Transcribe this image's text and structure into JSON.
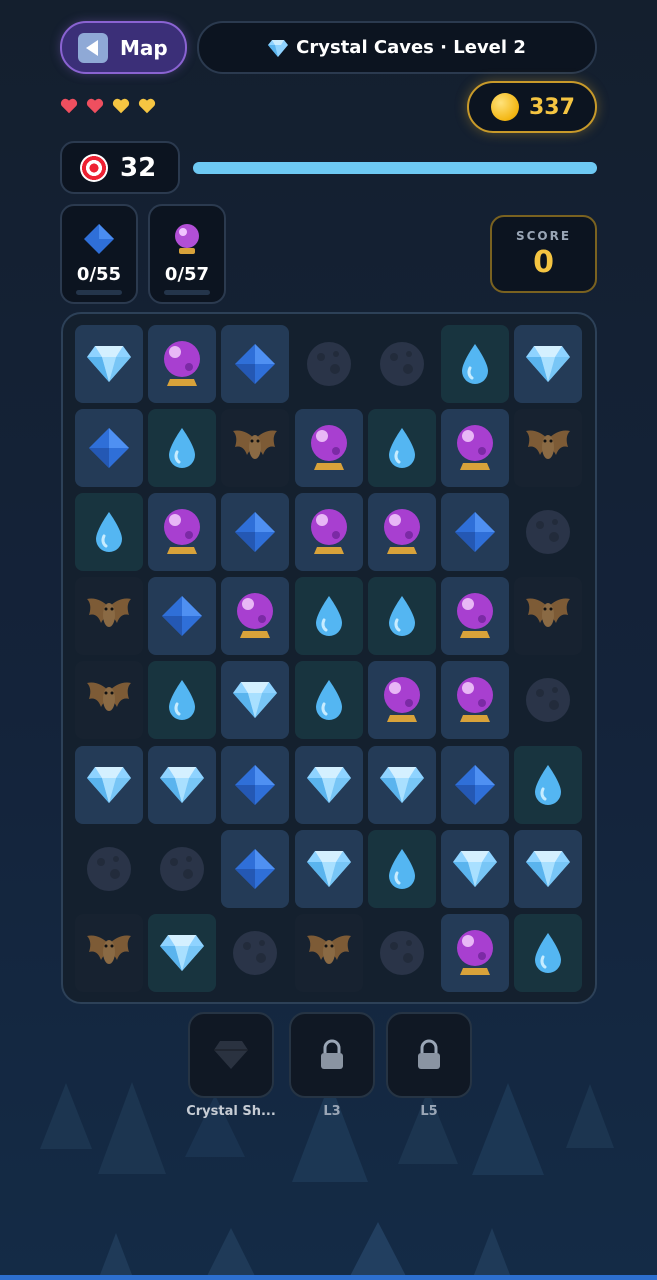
{
  "header": {
    "map_label": "Map",
    "level_title": "Crystal Caves · Level 2"
  },
  "lives": {
    "full": 2,
    "partial": 2,
    "colors": [
      "#ef4f5f",
      "#ef4f5f",
      "#f5c542",
      "#f5c542"
    ]
  },
  "coins": "337",
  "moves": "32",
  "move_progress": 1.0,
  "goals": [
    {
      "icon": "blue-diamond-icon",
      "count": "0/55"
    },
    {
      "icon": "crystal-ball-icon",
      "count": "0/57"
    }
  ],
  "score": {
    "label": "SCORE",
    "value": "0"
  },
  "board": {
    "rows": [
      [
        "gem",
        "ball",
        "diamond",
        "moon",
        "moon",
        "drop",
        "gem"
      ],
      [
        "diamond",
        "drop",
        "bat",
        "ball",
        "drop",
        "ball",
        "bat"
      ],
      [
        "drop",
        "ball",
        "diamond",
        "ball",
        "ball",
        "diamond",
        "moon"
      ],
      [
        "bat",
        "diamond",
        "ball",
        "drop",
        "drop",
        "ball",
        "bat"
      ],
      [
        "bat",
        "drop",
        "gem",
        "drop",
        "ball",
        "ball",
        "moon"
      ],
      [
        "gem",
        "gem",
        "diamond",
        "gem",
        "gem",
        "diamond",
        "drop"
      ],
      [
        "moon",
        "moon",
        "diamond",
        "gem",
        "drop",
        "gem",
        "gem"
      ],
      [
        "bat",
        "gem",
        "moon",
        "bat",
        "moon",
        "ball",
        "drop"
      ]
    ],
    "cell_bg": [
      [
        "blue",
        "blue",
        "blue",
        "none",
        "none",
        "teal",
        "blue"
      ],
      [
        "blue",
        "teal",
        "dark",
        "blue",
        "teal",
        "blue",
        "dark"
      ],
      [
        "teal",
        "blue",
        "blue",
        "blue",
        "blue",
        "blue",
        "none"
      ],
      [
        "dark",
        "blue",
        "blue",
        "teal",
        "teal",
        "blue",
        "dark"
      ],
      [
        "dark",
        "teal",
        "blue",
        "teal",
        "blue",
        "blue",
        "none"
      ],
      [
        "blue",
        "blue",
        "blue",
        "blue",
        "blue",
        "blue",
        "teal"
      ],
      [
        "none",
        "none",
        "blue",
        "blue",
        "teal",
        "blue",
        "blue"
      ],
      [
        "dark",
        "teal",
        "none",
        "dark",
        "none",
        "blue",
        "teal"
      ]
    ]
  },
  "boosters": [
    {
      "label": "Crystal Sh...",
      "icon": "crystal-shard-icon",
      "locked": false
    },
    {
      "label": "L3",
      "icon": "lock-icon",
      "locked": true
    },
    {
      "label": "L5",
      "icon": "lock-icon",
      "locked": true
    }
  ]
}
